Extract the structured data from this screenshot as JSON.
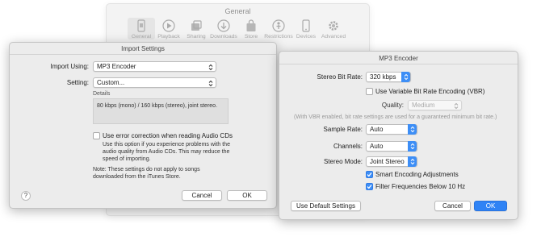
{
  "general_window": {
    "title": "General",
    "toolbar": [
      {
        "label": "General",
        "icon": "phone-switch-icon",
        "selected": true
      },
      {
        "label": "Playback",
        "icon": "play-icon"
      },
      {
        "label": "Sharing",
        "icon": "sharing-icon"
      },
      {
        "label": "Downloads",
        "icon": "download-icon"
      },
      {
        "label": "Store",
        "icon": "store-bag-icon"
      },
      {
        "label": "Restrictions",
        "icon": "restrictions-icon"
      },
      {
        "label": "Devices",
        "icon": "phone-icon"
      },
      {
        "label": "Advanced",
        "icon": "gear-icon"
      }
    ]
  },
  "import_settings": {
    "title": "Import Settings",
    "import_using_label": "Import Using:",
    "import_using_value": "MP3 Encoder",
    "setting_label": "Setting:",
    "setting_value": "Custom...",
    "details_label": "Details",
    "details_text": "80 kbps (mono) / 160 kbps (stereo), joint stereo.",
    "error_correction_label": "Use error correction when reading Audio CDs",
    "error_correction_checked": false,
    "error_correction_note": "Use this option if you experience problems with the audio quality from Audio CDs. This may reduce the speed of importing.",
    "footnote": "Note: These settings do not apply to songs downloaded from the iTunes Store.",
    "help_label": "?",
    "cancel_label": "Cancel",
    "ok_label": "OK"
  },
  "mp3_encoder": {
    "title": "MP3 Encoder",
    "stereo_bit_rate_label": "Stereo Bit Rate:",
    "stereo_bit_rate_value": "320 kbps",
    "vbr_label": "Use Variable Bit Rate Encoding (VBR)",
    "vbr_checked": false,
    "quality_label": "Quality:",
    "quality_value": "Medium",
    "vbr_note": "(With VBR enabled, bit rate settings are used for a guaranteed minimum bit rate.)",
    "sample_rate_label": "Sample Rate:",
    "sample_rate_value": "Auto",
    "channels_label": "Channels:",
    "channels_value": "Auto",
    "stereo_mode_label": "Stereo Mode:",
    "stereo_mode_value": "Joint Stereo",
    "smart_encoding_label": "Smart Encoding Adjustments",
    "smart_encoding_checked": true,
    "filter_label": "Filter Frequencies Below 10 Hz",
    "filter_checked": true,
    "use_default_label": "Use Default Settings",
    "cancel_label": "Cancel",
    "ok_label": "OK"
  },
  "colors": {
    "accent": "#3d8ef6",
    "default_button": "#2f83f5",
    "window_bg": "#ececec"
  }
}
